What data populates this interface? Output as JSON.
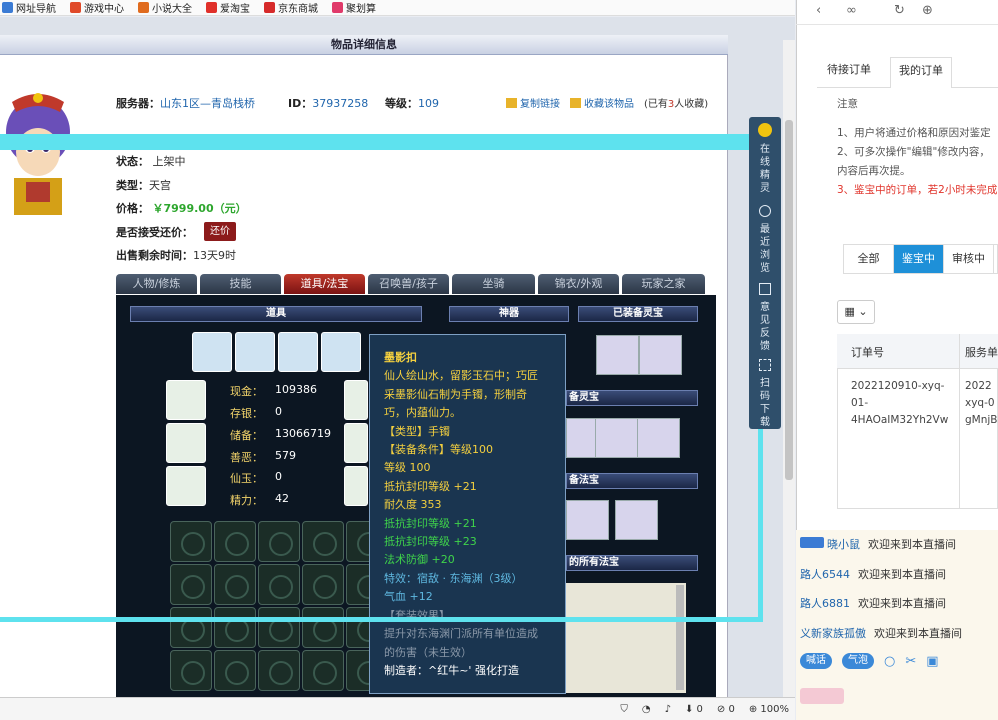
{
  "bookmarks": [
    {
      "label": "网址导航",
      "color": "#3b7bd4"
    },
    {
      "label": "游戏中心",
      "color": "#e04a2a"
    },
    {
      "label": "小说大全",
      "color": "#e06b1e"
    },
    {
      "label": "爱淘宝",
      "color": "#e0302a"
    },
    {
      "label": "京东商城",
      "color": "#d62a2a"
    },
    {
      "label": "聚划算",
      "color": "#e03a6a"
    }
  ],
  "page": {
    "title": "物品详细信息",
    "server_label": "服务器：",
    "server_value": "山东1区—青岛栈桥",
    "id_label": "ID：",
    "id_value": "37937258",
    "level_label": "等级：",
    "level_value": "109",
    "copy_link": "复制链接",
    "favorite": "收藏该物品",
    "fav_count_prefix": "(已有",
    "fav_count": "3",
    "fav_count_suffix": "人收藏)",
    "status_label": "状态：",
    "status_value": "上架中",
    "type_label": "类型：",
    "type_value": "天宫",
    "price_label": "价格：",
    "price_value": "￥7999.00（元）",
    "haggle_label": "是否接受还价：",
    "haggle_button": "还价",
    "time_label": "出售剩余时间：",
    "time_value": "13天9时"
  },
  "tabs": [
    "人物/修炼",
    "技能",
    "道具/法宝",
    "召唤兽/孩子",
    "坐骑",
    "锦衣/外观",
    "玩家之家"
  ],
  "active_tab": 2,
  "game": {
    "hdr_items": "道具",
    "hdr_artifact": "神器",
    "hdr_spirit": "已装备灵宝",
    "hdr_spirit2": "备灵宝",
    "hdr_fabao": "备法宝",
    "hdr_allfabao": "的所有法宝",
    "stats": [
      {
        "label": "现金：",
        "value": "109386"
      },
      {
        "label": "存银：",
        "value": "0"
      },
      {
        "label": "储备：",
        "value": "13066719"
      },
      {
        "label": "善恶：",
        "value": "579"
      },
      {
        "label": "仙玉：",
        "value": "0"
      },
      {
        "label": "精力：",
        "value": "42"
      }
    ]
  },
  "tooltip": {
    "name": "墨影扣",
    "desc": [
      "仙人绘山水，留影玉石中；巧匠",
      "采墨影仙石制为手镯，形制奇",
      "巧，内蕴仙力。"
    ],
    "type": "【类型】手镯",
    "req": "【装备条件】等级100",
    "level": "等级  100",
    "attr1": "抵抗封印等级  +21",
    "durability": "耐久度  353",
    "attr2": "抵抗封印等级  +21",
    "attr3": "抵抗封印等级  +23",
    "attr4": "法术防御  +20",
    "effect": "特效：宿敌 · 东海渊（3级）",
    "hp": "气血  +12",
    "set": "【套装效果】",
    "set_desc": [
      "提升对东海渊门派所有单位造成",
      "的伤害（未生效）"
    ],
    "maker": "制造者：^红牛~' 强化打造"
  },
  "sidebar": [
    "在线精灵",
    "最近浏览",
    "意见反馈",
    "扫码下载"
  ],
  "right": {
    "tabs": [
      "待接订单",
      "我的订单"
    ],
    "note_title": "注意",
    "notes": [
      "1、用户将通过价格和原因对鉴定",
      "2、可多次操作\"编辑\"修改内容，",
      "内容后再次提。",
      "3、鉴宝中的订单，若2小时未完成"
    ],
    "filters": [
      "全部",
      "鉴宝中",
      "审核中"
    ],
    "active_filter": 1,
    "table_headers": [
      "订单号",
      "服务单"
    ],
    "order_no": [
      "2022120910-xyq-",
      "01-",
      "4HAOaIM32Yh2Vw"
    ],
    "order_srv": [
      "2022",
      "xyq-0",
      "gMnjB"
    ]
  },
  "chat": [
    {
      "user": "晓小鼠",
      "text": "欢迎来到本直播间"
    },
    {
      "user": "路人6544",
      "text": "欢迎来到本直播间"
    },
    {
      "user": "路人6881",
      "text": "欢迎来到本直播间"
    },
    {
      "user": "义新家族孤傲",
      "text": "欢迎来到本直播间"
    }
  ],
  "chat_buttons": [
    "喊话",
    "气泡"
  ],
  "statusbar": {
    "count1": "0",
    "count2": "0",
    "zoom": "100%"
  }
}
